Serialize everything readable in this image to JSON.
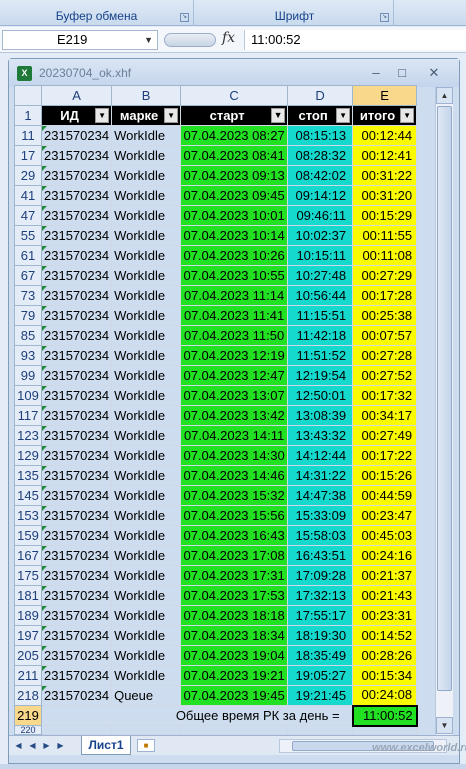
{
  "ribbon": {
    "groups": [
      {
        "label": "Буфер обмена"
      },
      {
        "label": "Шрифт"
      }
    ]
  },
  "formula_bar": {
    "name_box": "E219",
    "fx_label": "fx",
    "formula": "11:00:52"
  },
  "window": {
    "title": "20230704_ok.xhf",
    "icon_text": "X"
  },
  "columns": [
    "A",
    "B",
    "C",
    "D",
    "E"
  ],
  "header_row": {
    "row_num": "1",
    "cells": [
      "ИД",
      "марке",
      "старт",
      "стоп",
      "итого"
    ]
  },
  "rows": [
    {
      "n": "11",
      "id": "231570234",
      "marker": "WorkIdle",
      "start": "07.04.2023 08:27",
      "stop": "08:15:13",
      "total": "00:12:44"
    },
    {
      "n": "17",
      "id": "231570234",
      "marker": "WorkIdle",
      "start": "07.04.2023 08:41",
      "stop": "08:28:32",
      "total": "00:12:41"
    },
    {
      "n": "29",
      "id": "231570234",
      "marker": "WorkIdle",
      "start": "07.04.2023 09:13",
      "stop": "08:42:02",
      "total": "00:31:22"
    },
    {
      "n": "41",
      "id": "231570234",
      "marker": "WorkIdle",
      "start": "07.04.2023 09:45",
      "stop": "09:14:12",
      "total": "00:31:20"
    },
    {
      "n": "47",
      "id": "231570234",
      "marker": "WorkIdle",
      "start": "07.04.2023 10:01",
      "stop": "09:46:11",
      "total": "00:15:29"
    },
    {
      "n": "55",
      "id": "231570234",
      "marker": "WorkIdle",
      "start": "07.04.2023 10:14",
      "stop": "10:02:37",
      "total": "00:11:55"
    },
    {
      "n": "61",
      "id": "231570234",
      "marker": "WorkIdle",
      "start": "07.04.2023 10:26",
      "stop": "10:15:11",
      "total": "00:11:08"
    },
    {
      "n": "67",
      "id": "231570234",
      "marker": "WorkIdle",
      "start": "07.04.2023 10:55",
      "stop": "10:27:48",
      "total": "00:27:29"
    },
    {
      "n": "73",
      "id": "231570234",
      "marker": "WorkIdle",
      "start": "07.04.2023 11:14",
      "stop": "10:56:44",
      "total": "00:17:28"
    },
    {
      "n": "79",
      "id": "231570234",
      "marker": "WorkIdle",
      "start": "07.04.2023 11:41",
      "stop": "11:15:51",
      "total": "00:25:38"
    },
    {
      "n": "85",
      "id": "231570234",
      "marker": "WorkIdle",
      "start": "07.04.2023 11:50",
      "stop": "11:42:18",
      "total": "00:07:57"
    },
    {
      "n": "93",
      "id": "231570234",
      "marker": "WorkIdle",
      "start": "07.04.2023 12:19",
      "stop": "11:51:52",
      "total": "00:27:28"
    },
    {
      "n": "99",
      "id": "231570234",
      "marker": "WorkIdle",
      "start": "07.04.2023 12:47",
      "stop": "12:19:54",
      "total": "00:27:52"
    },
    {
      "n": "109",
      "id": "231570234",
      "marker": "WorkIdle",
      "start": "07.04.2023 13:07",
      "stop": "12:50:01",
      "total": "00:17:32"
    },
    {
      "n": "117",
      "id": "231570234",
      "marker": "WorkIdle",
      "start": "07.04.2023 13:42",
      "stop": "13:08:39",
      "total": "00:34:17"
    },
    {
      "n": "123",
      "id": "231570234",
      "marker": "WorkIdle",
      "start": "07.04.2023 14:11",
      "stop": "13:43:32",
      "total": "00:27:49"
    },
    {
      "n": "129",
      "id": "231570234",
      "marker": "WorkIdle",
      "start": "07.04.2023 14:30",
      "stop": "14:12:44",
      "total": "00:17:22"
    },
    {
      "n": "135",
      "id": "231570234",
      "marker": "WorkIdle",
      "start": "07.04.2023 14:46",
      "stop": "14:31:22",
      "total": "00:15:26"
    },
    {
      "n": "145",
      "id": "231570234",
      "marker": "WorkIdle",
      "start": "07.04.2023 15:32",
      "stop": "14:47:38",
      "total": "00:44:59"
    },
    {
      "n": "153",
      "id": "231570234",
      "marker": "WorkIdle",
      "start": "07.04.2023 15:56",
      "stop": "15:33:09",
      "total": "00:23:47"
    },
    {
      "n": "159",
      "id": "231570234",
      "marker": "WorkIdle",
      "start": "07.04.2023 16:43",
      "stop": "15:58:03",
      "total": "00:45:03"
    },
    {
      "n": "167",
      "id": "231570234",
      "marker": "WorkIdle",
      "start": "07.04.2023 17:08",
      "stop": "16:43:51",
      "total": "00:24:16"
    },
    {
      "n": "175",
      "id": "231570234",
      "marker": "WorkIdle",
      "start": "07.04.2023 17:31",
      "stop": "17:09:28",
      "total": "00:21:37"
    },
    {
      "n": "181",
      "id": "231570234",
      "marker": "WorkIdle",
      "start": "07.04.2023 17:53",
      "stop": "17:32:13",
      "total": "00:21:43"
    },
    {
      "n": "189",
      "id": "231570234",
      "marker": "WorkIdle",
      "start": "07.04.2023 18:18",
      "stop": "17:55:17",
      "total": "00:23:31"
    },
    {
      "n": "197",
      "id": "231570234",
      "marker": "WorkIdle",
      "start": "07.04.2023 18:34",
      "stop": "18:19:30",
      "total": "00:14:52"
    },
    {
      "n": "205",
      "id": "231570234",
      "marker": "WorkIdle",
      "start": "07.04.2023 19:04",
      "stop": "18:35:49",
      "total": "00:28:26"
    },
    {
      "n": "211",
      "id": "231570234",
      "marker": "WorkIdle",
      "start": "07.04.2023 19:21",
      "stop": "19:05:27",
      "total": "00:15:34"
    },
    {
      "n": "218",
      "id": "231570234",
      "marker": "Queue",
      "start": "07.04.2023 19:45",
      "stop": "19:21:45",
      "total": "00:24:08"
    }
  ],
  "total_row": {
    "n": "219",
    "label": "Общее время РК за день  =",
    "value": "11:00:52"
  },
  "partial_row": "220",
  "sheet_tab": "Лист1",
  "watermark": "www.excelworld.ru"
}
